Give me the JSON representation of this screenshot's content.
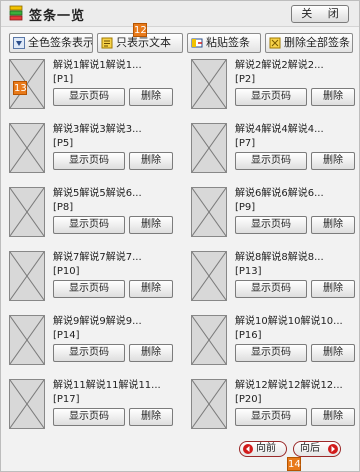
{
  "window": {
    "title": "签条一览",
    "close_label": "关 闭"
  },
  "toolbar": {
    "all_label": "全色签条表示",
    "text_only_label": "只表示文本",
    "paste_label": "粘贴签条",
    "delete_all_label": "删除全部签条"
  },
  "badges": {
    "toolbar": "12",
    "thumb": "13",
    "pager": "14"
  },
  "card_buttons": {
    "show": "显示页码",
    "delete": "删除"
  },
  "notes": [
    {
      "text": "解说1解说1解说1...",
      "page": "[P1]"
    },
    {
      "text": "解说2解说2解说2...",
      "page": "[P2]"
    },
    {
      "text": "解说3解说3解说3...",
      "page": "[P5]"
    },
    {
      "text": "解说4解说4解说4...",
      "page": "[P7]"
    },
    {
      "text": "解说5解说5解说6...",
      "page": "[P8]"
    },
    {
      "text": "解说6解说6解说6...",
      "page": "[P9]"
    },
    {
      "text": "解说7解说7解说7...",
      "page": "[P10]"
    },
    {
      "text": "解说8解说8解说8...",
      "page": "[P13]"
    },
    {
      "text": "解说9解说9解说9...",
      "page": "[P14]"
    },
    {
      "text": "解说10解说10解说10...",
      "page": "[P16]"
    },
    {
      "text": "解说11解说11解说11...",
      "page": "[P17]"
    },
    {
      "text": "解说12解说12解说12...",
      "page": "[P20]"
    }
  ],
  "pager": {
    "prev_label": "向前",
    "next_label": "向后"
  }
}
